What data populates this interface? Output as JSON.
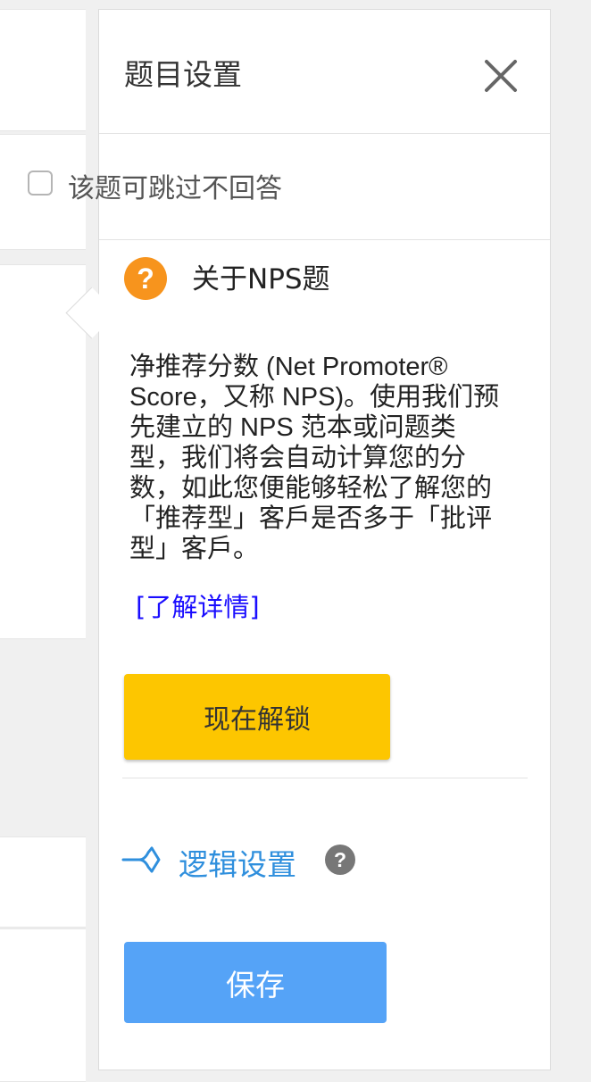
{
  "panel": {
    "title": "题目设置",
    "skip_label": "该题可跳过不回答",
    "skip_checked": false
  },
  "about": {
    "title": "关于NPS题",
    "description": "净推荐分数 (Net Promoter® Score，又称 NPS)。使用我们预先建立的 NPS 范本或问题类型，我们将会自动计算您的分数，如此您便能够轻松了解您的「推荐型」客戶是否多于「批评型」客戶。",
    "learn_more": "[了解详情]"
  },
  "actions": {
    "unlock_label": "现在解锁",
    "logic_label": "逻辑设置",
    "save_label": "保存"
  },
  "icons": {
    "close": "close-icon",
    "about": "question-circle-icon",
    "logic": "branch-arrow-icon",
    "help": "help-circle-icon"
  },
  "colors": {
    "unlock": "#fdc600",
    "save": "#55a3f7",
    "link": "#1a0dff",
    "logic": "#2f8fdd",
    "question_icon": "#f7941d"
  }
}
